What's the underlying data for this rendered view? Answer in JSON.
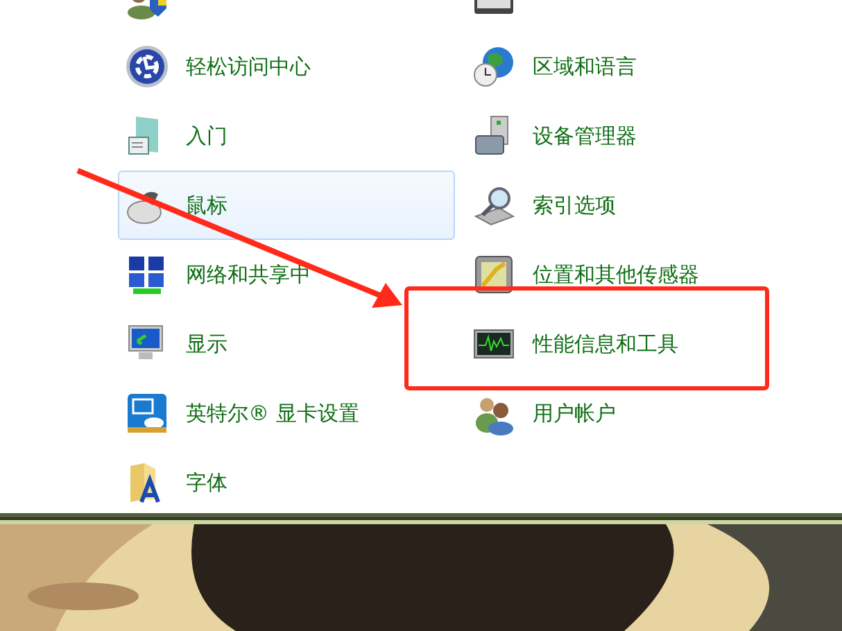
{
  "items": [
    {
      "label": "轻松访问中心",
      "hovered": false
    },
    {
      "label": "区域和语言",
      "hovered": false
    },
    {
      "label": "入门",
      "hovered": false
    },
    {
      "label": "设备管理器",
      "hovered": false
    },
    {
      "label": "鼠标",
      "hovered": true
    },
    {
      "label": "索引选项",
      "hovered": false
    },
    {
      "label": "网络和共享中",
      "hovered": false
    },
    {
      "label": "位置和其他传感器",
      "hovered": false
    },
    {
      "label": "显示",
      "hovered": false
    },
    {
      "label": "性能信息和工具",
      "hovered": false
    },
    {
      "label": "英特尔® 显卡设置",
      "hovered": false
    },
    {
      "label": "用户帐户",
      "hovered": false
    },
    {
      "label": "字体",
      "hovered": false
    }
  ]
}
